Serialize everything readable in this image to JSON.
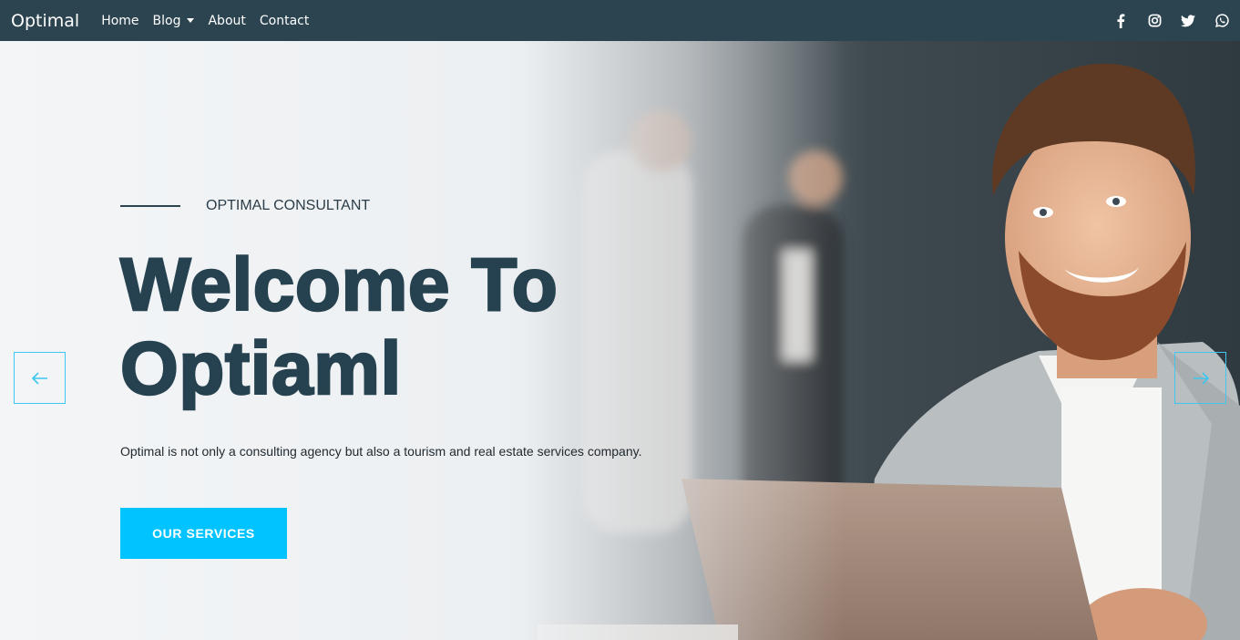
{
  "navbar": {
    "brand": "Optimal",
    "items": [
      {
        "label": "Home"
      },
      {
        "label": "Blog"
      },
      {
        "label": "About"
      },
      {
        "label": "Contact"
      }
    ],
    "social_icons": [
      "facebook-icon",
      "instagram-icon",
      "twitter-icon",
      "whatsapp-icon"
    ]
  },
  "hero": {
    "eyebrow": "OPTIMAL CONSULTANT",
    "title_line1": "Welcome To",
    "title_line2": "Optiaml",
    "description": "Optimal is not only a consulting agency but also a tourism and real estate services company.",
    "cta_label": "OUR SERVICES",
    "prev_icon": "arrow-left-icon",
    "next_icon": "arrow-right-icon"
  },
  "colors": {
    "navbar_bg": "#2b4450",
    "title": "#26414f",
    "accent": "#00c3ff"
  }
}
